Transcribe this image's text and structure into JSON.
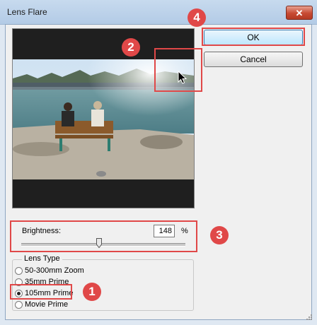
{
  "window": {
    "title": "Lens Flare",
    "close_glyph": "✕"
  },
  "buttons": {
    "ok": "OK",
    "cancel": "Cancel"
  },
  "brightness": {
    "label": "Brightness:",
    "value": "148",
    "unit": "%",
    "slider_min": 10,
    "slider_max": 300,
    "slider_value": 148
  },
  "lens_type": {
    "legend": "Lens Type",
    "options": [
      {
        "label": "50-300mm Zoom",
        "selected": false
      },
      {
        "label": "35mm Prime",
        "selected": false
      },
      {
        "label": "105mm Prime",
        "selected": true
      },
      {
        "label": "Movie Prime",
        "selected": false
      }
    ]
  },
  "annotations": {
    "badge_1": "1",
    "badge_2": "2",
    "badge_3": "3",
    "badge_4": "4",
    "color": "#e04848"
  },
  "icons": [
    "close-icon",
    "mouse-cursor-icon",
    "slider-thumb-icon",
    "resize-grip-icon"
  ]
}
